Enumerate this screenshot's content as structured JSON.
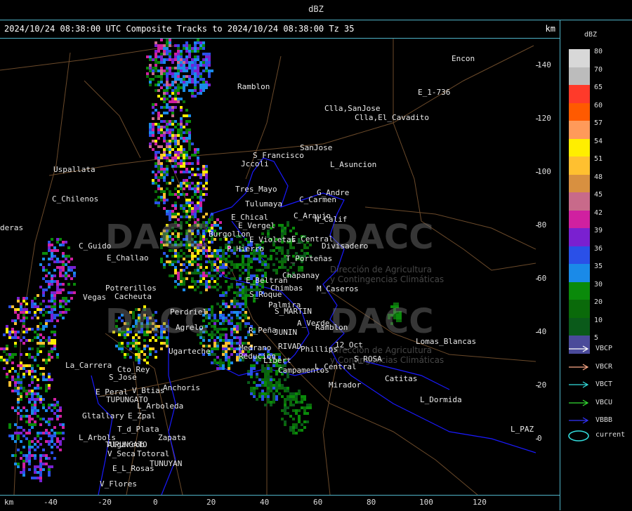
{
  "window": {
    "title": "dBZ"
  },
  "header": {
    "caption": "2024/10/24 08:38:00 UTC Composite Tracks to 2024/10/24 08:38:00 Tz 35",
    "unit_right": "km",
    "unit_bottom": "km"
  },
  "axes": {
    "y_ticks": [
      "140",
      "120",
      "100",
      "80",
      "60",
      "40",
      "20",
      "0"
    ],
    "x_ticks": [
      "-40",
      "-20",
      "0",
      "20",
      "40",
      "60",
      "80",
      "100",
      "120"
    ]
  },
  "legend": {
    "title": "dBZ",
    "levels": [
      {
        "label": "80",
        "color": "#d8d8d8"
      },
      {
        "label": "70",
        "color": "#bcbcbc"
      },
      {
        "label": "65",
        "color": "#ff3a2a"
      },
      {
        "label": "60",
        "color": "#ff5a00"
      },
      {
        "label": "57",
        "color": "#ff9a5a"
      },
      {
        "label": "54",
        "color": "#ffee00"
      },
      {
        "label": "51",
        "color": "#ffc030"
      },
      {
        "label": "48",
        "color": "#d89040"
      },
      {
        "label": "45",
        "color": "#c86a8a"
      },
      {
        "label": "42",
        "color": "#d020a0"
      },
      {
        "label": "39",
        "color": "#7a20d0"
      },
      {
        "label": "36",
        "color": "#2a50e8"
      },
      {
        "label": "35",
        "color": "#1a8ae8"
      },
      {
        "label": "30",
        "color": "#0a8a0a"
      },
      {
        "label": "20",
        "color": "#0a6a0a"
      },
      {
        "label": "10",
        "color": "#0a5a1a"
      },
      {
        "label": "5",
        "color": "#4a4a9a"
      }
    ],
    "tracks": [
      {
        "label": "VBCP",
        "color": "#ffffff"
      },
      {
        "label": "VBCR",
        "color": "#ffaa88"
      },
      {
        "label": "VBCT",
        "color": "#33dddd"
      },
      {
        "label": "VBCU",
        "color": "#33dd33"
      },
      {
        "label": "VBBB",
        "color": "#3333ff"
      }
    ],
    "current_label": "current",
    "current_color": "#33dddd"
  },
  "watermark": {
    "brand": "DACC",
    "subtitle1": "Dirección de Agricultura",
    "subtitle2": "y Contingencias Climáticas"
  },
  "places": [
    {
      "name": "Encon"
    },
    {
      "name": "Ramblon"
    },
    {
      "name": "E_1-736"
    },
    {
      "name": "Clla,SanJose"
    },
    {
      "name": "Clla,El_Cavadito"
    },
    {
      "name": "S_Francisco"
    },
    {
      "name": "SanJose"
    },
    {
      "name": "Jccoli"
    },
    {
      "name": "L_Asuncion"
    },
    {
      "name": "Uspallata"
    },
    {
      "name": "Tres_Mayo"
    },
    {
      "name": "G_Andre"
    },
    {
      "name": "Tulumaya"
    },
    {
      "name": "C_Carmen"
    },
    {
      "name": "C_Chilenos"
    },
    {
      "name": "E_Chical"
    },
    {
      "name": "C_Araujo"
    },
    {
      "name": "E_Vergel"
    },
    {
      "name": "N_Calif"
    },
    {
      "name": "deras"
    },
    {
      "name": "C_Guido"
    },
    {
      "name": "Burgollon"
    },
    {
      "name": "E_Violetas"
    },
    {
      "name": "E_Central"
    },
    {
      "name": "Divisadero"
    },
    {
      "name": "P_Hierro"
    },
    {
      "name": "E_Challao"
    },
    {
      "name": "T_Porteñas"
    },
    {
      "name": "Chapanay"
    },
    {
      "name": "Potrerillos"
    },
    {
      "name": "E_Beltran"
    },
    {
      "name": "Chimbas"
    },
    {
      "name": "M_Caseros"
    },
    {
      "name": "Vegas"
    },
    {
      "name": "Cacheuta"
    },
    {
      "name": "S_Roque"
    },
    {
      "name": "Perdriel"
    },
    {
      "name": "Palmira"
    },
    {
      "name": "S_MARTIN"
    },
    {
      "name": "Agrelo"
    },
    {
      "name": "A_Verde"
    },
    {
      "name": "Ramblon"
    },
    {
      "name": "R_Peña"
    },
    {
      "name": "JUNIN"
    },
    {
      "name": "Lomas_Blancas"
    },
    {
      "name": "Ugarteche"
    },
    {
      "name": "Phillips"
    },
    {
      "name": "12_Oct"
    },
    {
      "name": "RIVAD"
    },
    {
      "name": "Medrano"
    },
    {
      "name": "La_Carrera"
    },
    {
      "name": "Reducion"
    },
    {
      "name": "Libert"
    },
    {
      "name": "S_ROSA"
    },
    {
      "name": "Cto_Rey"
    },
    {
      "name": "L_Central"
    },
    {
      "name": "Campamentos"
    },
    {
      "name": "S_Jose"
    },
    {
      "name": "Catitas"
    },
    {
      "name": "Mirador"
    },
    {
      "name": "E_Peral"
    },
    {
      "name": "V_Btias"
    },
    {
      "name": "Anchoris"
    },
    {
      "name": "TUPUNGATO"
    },
    {
      "name": "L_Dormida"
    },
    {
      "name": "L_Arboleda"
    },
    {
      "name": "Gltallary"
    },
    {
      "name": "E_Zpal"
    },
    {
      "name": "T_d_Plata"
    },
    {
      "name": "L_PAZ"
    },
    {
      "name": "L_Arbols"
    },
    {
      "name": "Zapata"
    },
    {
      "name": "Algarrob"
    },
    {
      "name": "TUPUNGATO"
    },
    {
      "name": "V_Seca"
    },
    {
      "name": "Totoral"
    },
    {
      "name": "TUNUYAN"
    },
    {
      "name": "E_L_Rosas"
    },
    {
      "name": "V_Flores"
    }
  ]
}
